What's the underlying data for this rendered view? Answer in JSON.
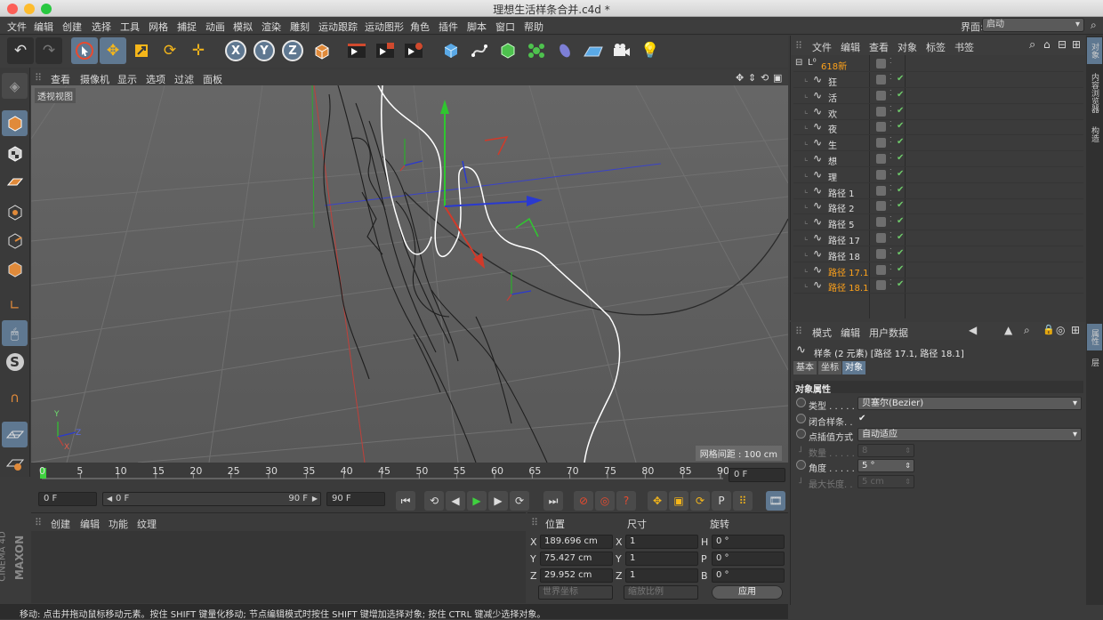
{
  "window": {
    "title": "理想生活样条合并.c4d *"
  },
  "menubar": {
    "items": [
      "文件",
      "编辑",
      "创建",
      "选择",
      "工具",
      "网格",
      "捕捉",
      "动画",
      "模拟",
      "渲染",
      "雕刻",
      "运动跟踪",
      "运动图形",
      "角色",
      "插件",
      "脚本",
      "窗口",
      "帮助"
    ],
    "layout_label": "界面:",
    "layout_value": "启动"
  },
  "toolbar": {
    "icons": [
      "undo-icon",
      "redo-icon",
      "live-select-icon",
      "move-icon",
      "scale-icon",
      "rotate-icon",
      "transform-icon",
      "x-axis-icon",
      "y-axis-icon",
      "z-axis-icon",
      "coordinate-system-icon",
      "render-view-icon",
      "render-picture-viewer-icon",
      "render-settings-icon",
      "cube-icon",
      "pen-icon",
      "subdivision-icon",
      "cloner-icon",
      "deformer-icon",
      "floor-icon",
      "camera-icon",
      "light-icon"
    ],
    "axis_labels": [
      "X",
      "Y",
      "Z"
    ]
  },
  "left_tools": {
    "icons": [
      "make-editable-icon",
      "model-mode-icon",
      "texture-mode-icon",
      "workplane-icon",
      "points-mode-icon",
      "edges-mode-icon",
      "polygons-mode-icon",
      "axis-mode-icon",
      "tweak-mode-icon",
      "solo-icon",
      "snap-icon",
      "lock-workplane-icon",
      "quantize-icon"
    ]
  },
  "viewport": {
    "menu": [
      "查看",
      "摄像机",
      "显示",
      "选项",
      "过滤",
      "面板"
    ],
    "label": "透视视图",
    "grid_spacing": "网格间距 : 100 cm",
    "axis": {
      "x": "X",
      "y": "Y",
      "z": "Z"
    }
  },
  "timeline": {
    "ticks": [
      "0",
      "5",
      "10",
      "15",
      "20",
      "25",
      "30",
      "35",
      "40",
      "45",
      "50",
      "55",
      "60",
      "65",
      "70",
      "75",
      "80",
      "85",
      "90"
    ],
    "current_frame": "0 F",
    "start_field": "0 F",
    "slider_start": "0 F",
    "slider_end": "90 F",
    "end_field": "90 F"
  },
  "material_panel": {
    "menu": [
      "创建",
      "编辑",
      "功能",
      "纹理"
    ]
  },
  "brand": {
    "line1": "MAXON",
    "line2": "CINEMA 4D"
  },
  "coordinates": {
    "headers": [
      "位置",
      "尺寸",
      "旋转"
    ],
    "rows": [
      {
        "axis": "X",
        "pos": "189.696 cm",
        "size_axis": "X",
        "size": "1",
        "rot_axis": "H",
        "rot": "0 °"
      },
      {
        "axis": "Y",
        "pos": "75.427 cm",
        "size_axis": "Y",
        "size": "1",
        "rot_axis": "P",
        "rot": "0 °"
      },
      {
        "axis": "Z",
        "pos": "29.952 cm",
        "size_axis": "Z",
        "size": "1",
        "rot_axis": "B",
        "rot": "0 °"
      }
    ],
    "mode_select": "世界坐标",
    "scale_select": "缩放比例",
    "apply_button": "应用"
  },
  "status": {
    "text": "移动: 点击并拖动鼠标移动元素。按住 SHIFT 键量化移动; 节点编辑模式时按住 SHIFT 键增加选择对象; 按住 CTRL 键减少选择对象。"
  },
  "objects": {
    "menu": [
      "文件",
      "编辑",
      "查看",
      "对象",
      "标签",
      "书签"
    ],
    "root": {
      "name": "618新"
    },
    "items": [
      {
        "name": "狂",
        "selected": false
      },
      {
        "name": "活",
        "selected": false
      },
      {
        "name": "欢",
        "selected": false
      },
      {
        "name": "夜",
        "selected": false
      },
      {
        "name": "生",
        "selected": false
      },
      {
        "name": "想",
        "selected": false
      },
      {
        "name": "理",
        "selected": false
      },
      {
        "name": "路径 1",
        "selected": false
      },
      {
        "name": "路径 2",
        "selected": false
      },
      {
        "name": "路径 5",
        "selected": false
      },
      {
        "name": "路径 17",
        "selected": false
      },
      {
        "name": "路径 18",
        "selected": false
      },
      {
        "name": "路径 17.1",
        "selected": true
      },
      {
        "name": "路径 18.1",
        "selected": true
      }
    ]
  },
  "side_tabs": [
    "对象",
    "内容浏览器",
    "构造",
    "属性",
    "层"
  ],
  "attributes": {
    "menu": [
      "模式",
      "编辑",
      "用户数据"
    ],
    "header": "样条 (2 元素) [路径 17.1, 路径 18.1]",
    "tabs": [
      "基本",
      "坐标",
      "对象"
    ],
    "section": "对象属性",
    "fields": [
      {
        "label": "类型 . . . . . .",
        "value": "贝塞尔(Bezier)",
        "kind": "select",
        "enabled": true
      },
      {
        "label": "闭合样条. .",
        "value": "✔",
        "kind": "check",
        "enabled": true
      },
      {
        "label": "点插值方式",
        "value": "自动适应",
        "kind": "select",
        "enabled": true
      },
      {
        "label": "数量 . . . . . .",
        "value": "8",
        "kind": "num",
        "enabled": false
      },
      {
        "label": "角度 . . . . . .",
        "value": "5 °",
        "kind": "num",
        "enabled": true
      },
      {
        "label": "最大长度. .",
        "value": "5 cm",
        "kind": "num",
        "enabled": false
      }
    ]
  },
  "colors": {
    "accent": "#5f7891",
    "selected_object": "#ffa21a",
    "check": "#6ec96a",
    "viewport_bg": "#5f5f5f"
  }
}
